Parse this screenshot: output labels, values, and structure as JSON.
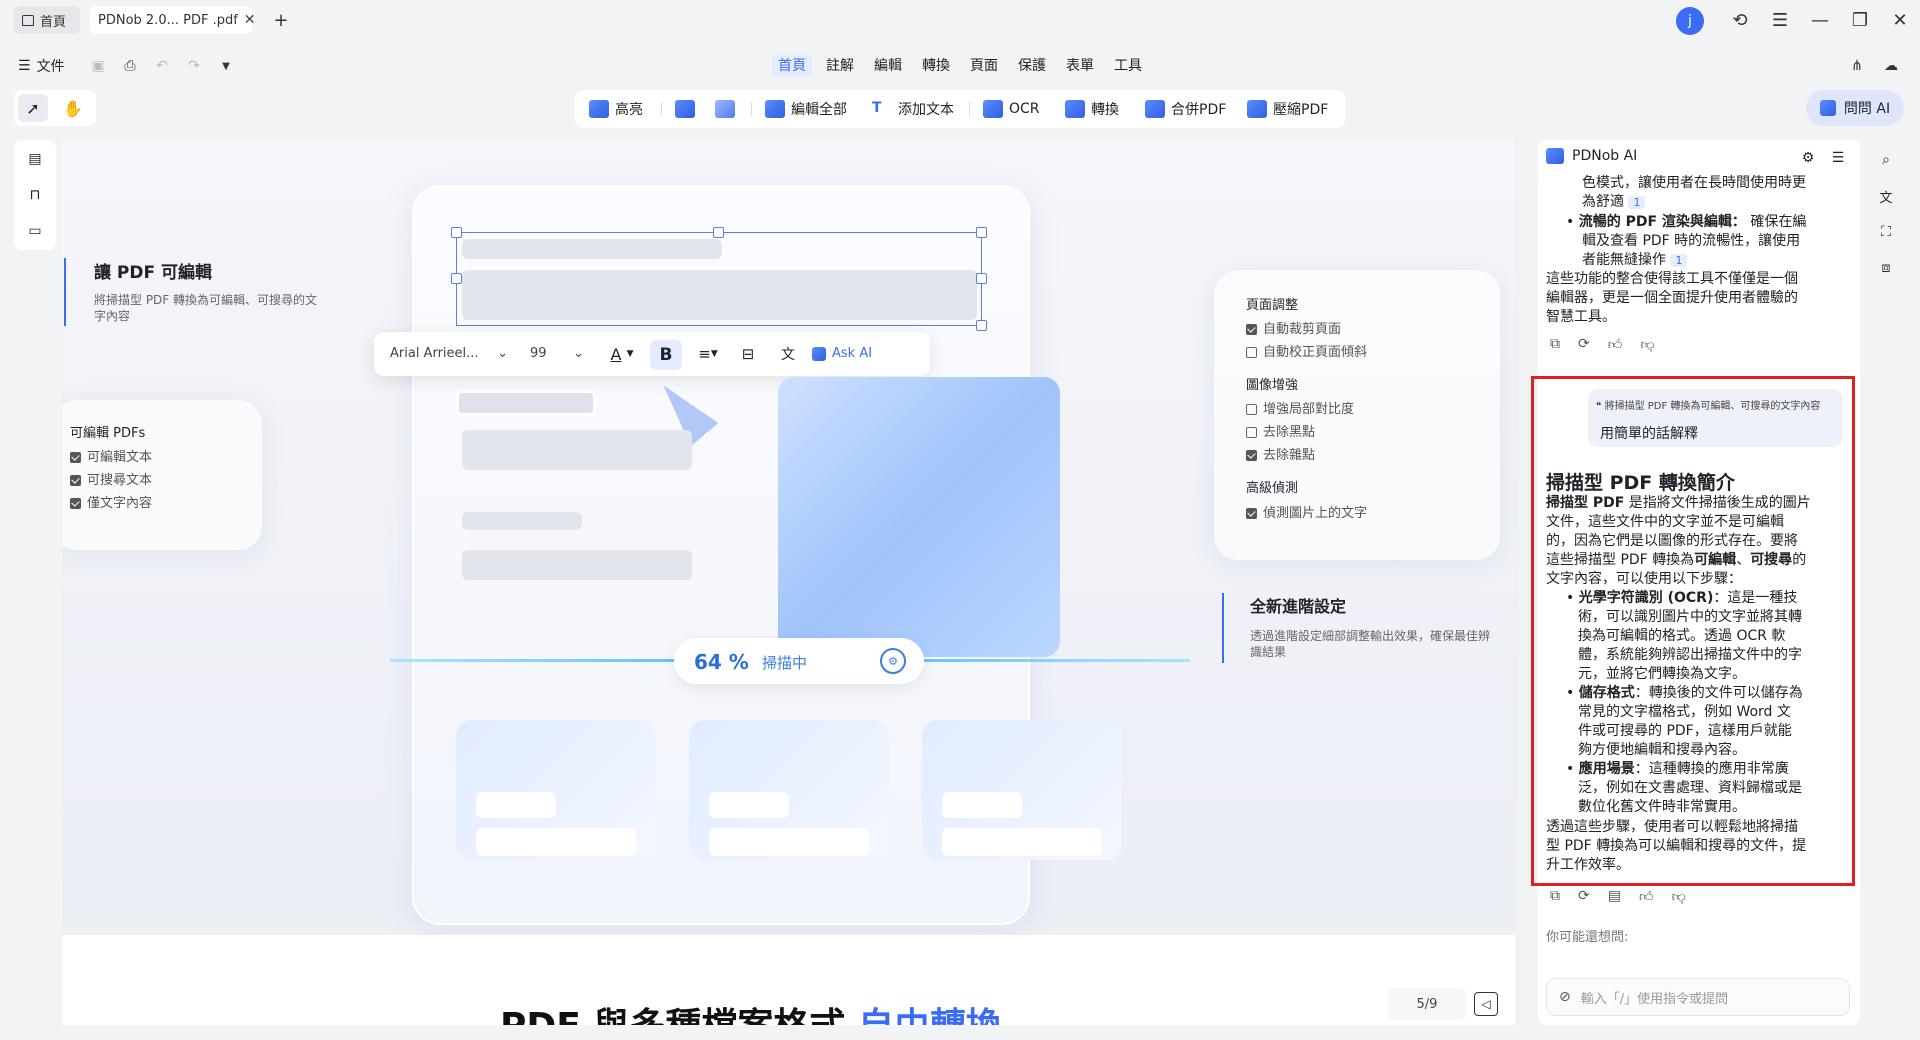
{
  "tabs": {
    "home": "首頁",
    "doc": "PDNob 2.0... PDF .pdf"
  },
  "window": {
    "avatar": "j"
  },
  "menu": {
    "file": "文件",
    "tabs": [
      "首頁",
      "註解",
      "編輯",
      "轉換",
      "頁面",
      "保護",
      "表單",
      "工具"
    ]
  },
  "toolbar": {
    "highlight": "高亮",
    "edit_all": "編輯全部",
    "add_text": "添加文本",
    "ocr": "OCR",
    "convert": "轉換",
    "merge": "合併PDF",
    "compress": "壓縮PDF",
    "ask_ai": "問問 AI"
  },
  "canvas": {
    "left_title": "讓 PDF 可編輯",
    "left_desc": "將掃描型 PDF 轉換為可編輯、可搜尋的文字內容",
    "editable_title": "可編輯 PDFs",
    "editable_items": [
      "可編輯文本",
      "可搜尋文本",
      "僅文字內容"
    ],
    "font": "Arial Arrieel...",
    "size": "99",
    "ask_ai": "Ask AI",
    "progress_value": "64 %",
    "progress_label": "掃描中",
    "page_adjust": "頁面調整",
    "auto_crop": "自動裁剪頁面",
    "auto_deskew": "自動校正頁面傾斜",
    "image_enhance": "圖像增強",
    "contrast": "增強局部對比度",
    "remove_black": "去除黑點",
    "remove_noise": "去除雜點",
    "advanced": "高級偵測",
    "detect_text": "偵測圖片上的文字",
    "new_settings": "全新進階設定",
    "new_settings_desc": "透過進階設定細部調整輸出效果，確保最佳辨識結果",
    "bottom_heading": "PDF 與多種檔案格式",
    "bottom_heading_accent": "自由轉換",
    "page_indicator": "5/9"
  },
  "ai": {
    "title": "PDNob AI",
    "prev_line1": "色模式，讓使用者在長時間使用時更",
    "prev_line2": "為舒適",
    "ref1": "1",
    "prev_b_label": "流暢的 PDF 渲染與編輯：",
    "prev_b_text1": "確保在編",
    "prev_b_text2": "輯及查看 PDF 時的流暢性，讓使用",
    "prev_b_text3": "者能無縫操作",
    "ref2": "1",
    "prev_sum": [
      "這些功能的整合使得該工具不僅僅是一個",
      "編輯器，更是一個全面提升使用者體驗的",
      "智慧工具。"
    ],
    "quote": "將掃描型 PDF 轉換為可編輯、可搜尋的文字內容",
    "user_msg": "用簡單的話解釋",
    "answer_title": "掃描型 PDF 轉換簡介",
    "p1_bold": "掃描型 PDF",
    "p1_lines": [
      "是指將文件掃描後生成的圖片",
      "文件，這些文件中的文字並不是可編輯",
      "的，因為它們是以圖像的形式存在。要將",
      "這些掃描型 PDF 轉換為"
    ],
    "p1_b2": "可編輯",
    "p1_mid": "、",
    "p1_b3": "可搜尋",
    "p1_tail": "的",
    "p1_last": "文字內容，可以使用以下步驟：",
    "b1_label": "光學字符識別 (OCR)",
    "b1_lines": [
      "：這是一種技",
      "術，可以識別圖片中的文字並將其轉",
      "換為可編輯的格式。透過 OCR 軟",
      "體，系統能夠辨認出掃描文件中的字",
      "元，並將它們轉換為文字。"
    ],
    "b2_label": "儲存格式",
    "b2_lines": [
      "：轉換後的文件可以儲存為",
      "常見的文字檔格式，例如 Word 文",
      "件或可搜尋的 PDF，這樣用戶就能",
      "夠方便地編輯和搜尋內容。"
    ],
    "b3_label": "應用場景",
    "b3_lines": [
      "：這種轉換的應用非常廣",
      "泛，例如在文書處理、資料歸檔或是",
      "數位化舊文件時非常實用。"
    ],
    "closing": [
      "透過這些步驟，使用者可以輕鬆地將掃描",
      "型 PDF 轉換為可以編輯和搜尋的文件，提",
      "升工作效率。"
    ],
    "suggest": "你可能還想問:",
    "input_placeholder": "輸入「/」使用指令或提問"
  },
  "colors": {
    "accent": "#3b6cf6",
    "highlight_border": "#e02020"
  }
}
